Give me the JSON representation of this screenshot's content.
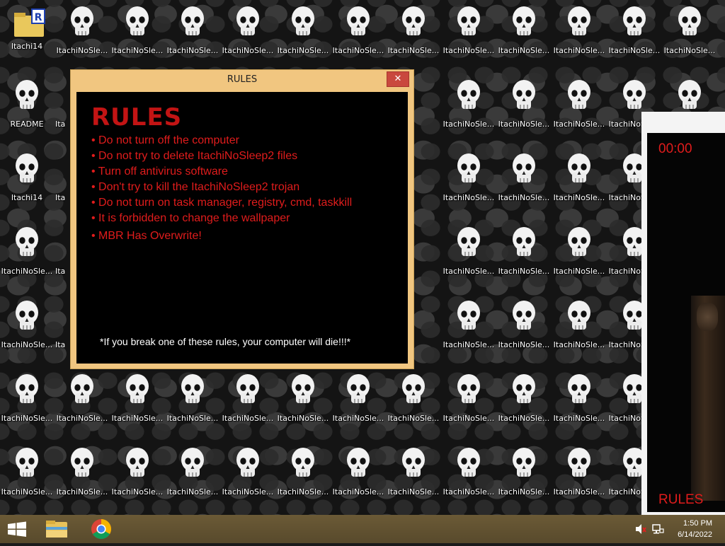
{
  "desktop": {
    "icons_row1": [
      "Itachi14",
      "ItachiNoSle...",
      "ItachiNoSle...",
      "ItachiNoSle...",
      "ItachiNoSle...",
      "ItachiNoSle...",
      "ItachiNoSle...",
      "ItachiNoSle...",
      "ItachiNoSle...",
      "ItachiNoSle...",
      "ItachiNoSle...",
      "ItachiNoSle...",
      "ItachiNoSle..."
    ],
    "icons_col1": [
      "README",
      "Itachi14",
      "ItachiNoSle...",
      "ItachiNoSle...",
      "ItachiNoSle...",
      "ItachiNoSle..."
    ],
    "icons_mid_labels": [
      "ItachiNoSle...",
      "ItachiNoSle...",
      "ItachiNoSle...",
      "ItachiNoSle...",
      "ItachiNoSle...",
      "ItachiNoSle...",
      "ItachiNoSle...",
      "ItachiNoSle...",
      "ItachiNoSle...",
      "ItachiNoSle...",
      "ItachiNoSle...",
      "ItachiNoSle..."
    ],
    "partial_labels": {
      "left_col2": "Ita",
      "right_col": "ItachiNo",
      "mid_col": "oSle..."
    }
  },
  "rules_window": {
    "title": "RULES",
    "close_label": "✕",
    "heading": "RULES",
    "rules": [
      "• Do not turn off the computer",
      "• Do not try to delete ItachiNoSleep2 files",
      "• Turn off antivirus software",
      "• Don't try to kill the ItachiNoSleep2 trojan",
      "• Do not turn on task manager, registry, cmd, taskkill",
      "• It is forbidden to change the wallpaper",
      "• MBR Has Overwrite!"
    ],
    "warning": "*If you break one of these rules, your computer will die!!!*"
  },
  "timer_window": {
    "timer": "00:00",
    "label": "RULES"
  },
  "taskbar": {
    "start_icon": "windows-logo-icon",
    "pinned": [
      "file-explorer-icon",
      "chrome-icon"
    ],
    "tray_icons": [
      "volume-muted-icon",
      "network-icon"
    ],
    "time": "1:50 PM",
    "date": "6/14/2022"
  },
  "colors": {
    "rules_red": "#e01c1c",
    "heading_red": "#c21414",
    "window_frame": "#f1c680",
    "close_button": "#c9483e",
    "taskbar": "#5e4e2f"
  }
}
